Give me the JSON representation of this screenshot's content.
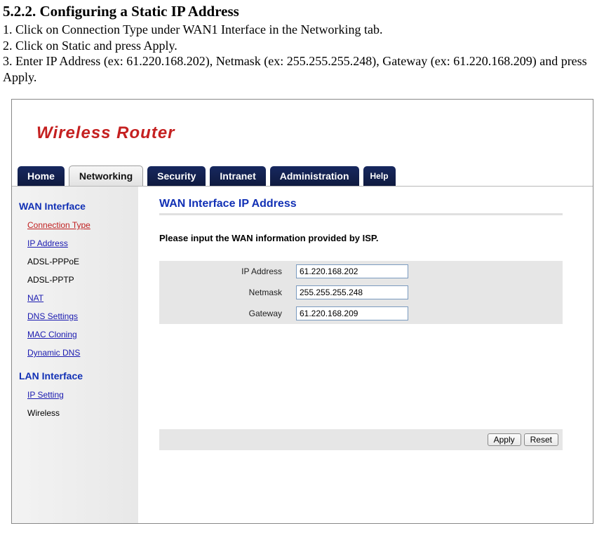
{
  "doc": {
    "section_heading": "5.2.2. Configuring a Static IP Address",
    "step1": "1. Click on Connection Type under WAN1 Interface in the Networking tab.",
    "step2": "2. Click on Static and press Apply.",
    "step3": "3. Enter IP Address (ex: 61.220.168.202), Netmask (ex: 255.255.255.248), Gateway (ex: 61.220.168.209) and press Apply."
  },
  "router": {
    "logo": "Wireless Router",
    "tabs": {
      "home": "Home",
      "networking": "Networking",
      "security": "Security",
      "intranet": "Intranet",
      "administration": "Administration",
      "help": "Help"
    },
    "sidebar": {
      "wan_heading": "WAN Interface",
      "items": {
        "connection_type": "Connection Type",
        "ip_address": "IP Address",
        "adsl_pppoe": "ADSL-PPPoE",
        "adsl_pptp": "ADSL-PPTP",
        "nat": "NAT",
        "dns_settings": "DNS Settings",
        "mac_cloning": "MAC Cloning",
        "dynamic_dns": "Dynamic DNS"
      },
      "lan_heading": "LAN Interface",
      "lan_items": {
        "ip_setting": "IP Setting",
        "wireless": "Wireless"
      }
    },
    "content": {
      "title": "WAN Interface IP Address",
      "instruction": "Please input the WAN information provided by ISP.",
      "labels": {
        "ip_address": "IP Address",
        "netmask": "Netmask",
        "gateway": "Gateway"
      },
      "values": {
        "ip_address": "61.220.168.202",
        "netmask": "255.255.255.248",
        "gateway": "61.220.168.209"
      },
      "buttons": {
        "apply": "Apply",
        "reset": "Reset"
      }
    }
  }
}
